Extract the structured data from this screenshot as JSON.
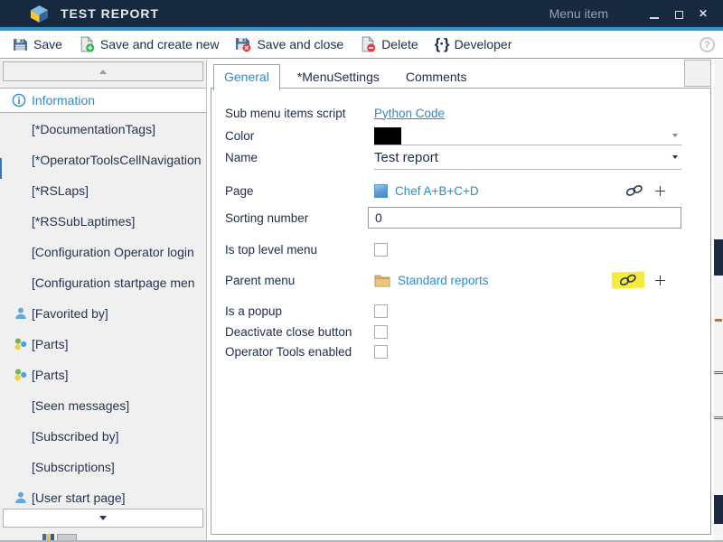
{
  "window": {
    "title": "TEST REPORT",
    "context_label": "Menu item",
    "app_icon": "cube-logo"
  },
  "toolbar": {
    "buttons": [
      {
        "label": "Save",
        "icon": "floppy-save-icon"
      },
      {
        "label": "Save and create new",
        "icon": "file-plus-icon"
      },
      {
        "label": "Save and close",
        "icon": "floppy-close-icon"
      },
      {
        "label": "Delete",
        "icon": "file-delete-icon"
      },
      {
        "label": "Developer",
        "icon": "code-braces-icon",
        "icon_glyph": "{·}"
      }
    ],
    "help": "?"
  },
  "sidebar": {
    "items": [
      {
        "label": "Information",
        "icon": "info-icon",
        "selected": true
      },
      {
        "label": "[*DocumentationTags]",
        "icon": null
      },
      {
        "label": "[*OperatorToolsCellNavigation",
        "icon": null
      },
      {
        "label": "[*RSLaps]",
        "icon": null
      },
      {
        "label": "[*RSSubLaptimes]",
        "icon": null
      },
      {
        "label": "[Configuration Operator login",
        "icon": null
      },
      {
        "label": "[Configuration startpage men",
        "icon": null
      },
      {
        "label": "[Favorited by]",
        "icon": "person-icon"
      },
      {
        "label": "[Parts]",
        "icon": "parts-icon"
      },
      {
        "label": "[Parts]",
        "icon": "parts-icon"
      },
      {
        "label": "[Seen messages]",
        "icon": null
      },
      {
        "label": "[Subscribed by]",
        "icon": null
      },
      {
        "label": "[Subscriptions]",
        "icon": null
      },
      {
        "label": "[User start page]",
        "icon": "person-icon"
      }
    ]
  },
  "tabs": [
    {
      "label": "General",
      "active": true
    },
    {
      "label": "*MenuSettings",
      "active": false
    },
    {
      "label": "Comments",
      "active": false
    }
  ],
  "form": {
    "rows": {
      "script": {
        "label": "Sub menu items script",
        "link": "Python Code",
        "type": "link"
      },
      "color": {
        "label": "Color",
        "value_hex": "#000000",
        "type": "color-dropdown"
      },
      "name": {
        "label": "Name",
        "value": "Test report",
        "type": "dropdown"
      },
      "page": {
        "label": "Page",
        "link": "Chef A+B+C+D",
        "icons": [
          "link-chain-icon",
          "plus-icon"
        ],
        "type": "reference-picker"
      },
      "sorting": {
        "label": "Sorting number",
        "value": "0",
        "type": "text-input"
      },
      "top_level": {
        "label": "Is top level menu",
        "checked": false,
        "type": "checkbox"
      },
      "parent": {
        "label": "Parent menu",
        "link": "Standard reports",
        "icons": [
          "link-chain-icon-highlighted",
          "plus-icon"
        ],
        "type": "reference-picker"
      },
      "popup": {
        "label": "Is a popup",
        "checked": false,
        "type": "checkbox"
      },
      "deactivate": {
        "label": "Deactivate close button",
        "checked": false,
        "type": "checkbox"
      },
      "operator": {
        "label": "Operator Tools enabled",
        "checked": false,
        "type": "checkbox"
      }
    }
  },
  "colors": {
    "titlebar": "#17293e",
    "accent_line": "#2d96d0",
    "link_blue": "#2e8bc7",
    "highlight_yellow": "#f6ea3e",
    "color_swatch": "#000000"
  }
}
